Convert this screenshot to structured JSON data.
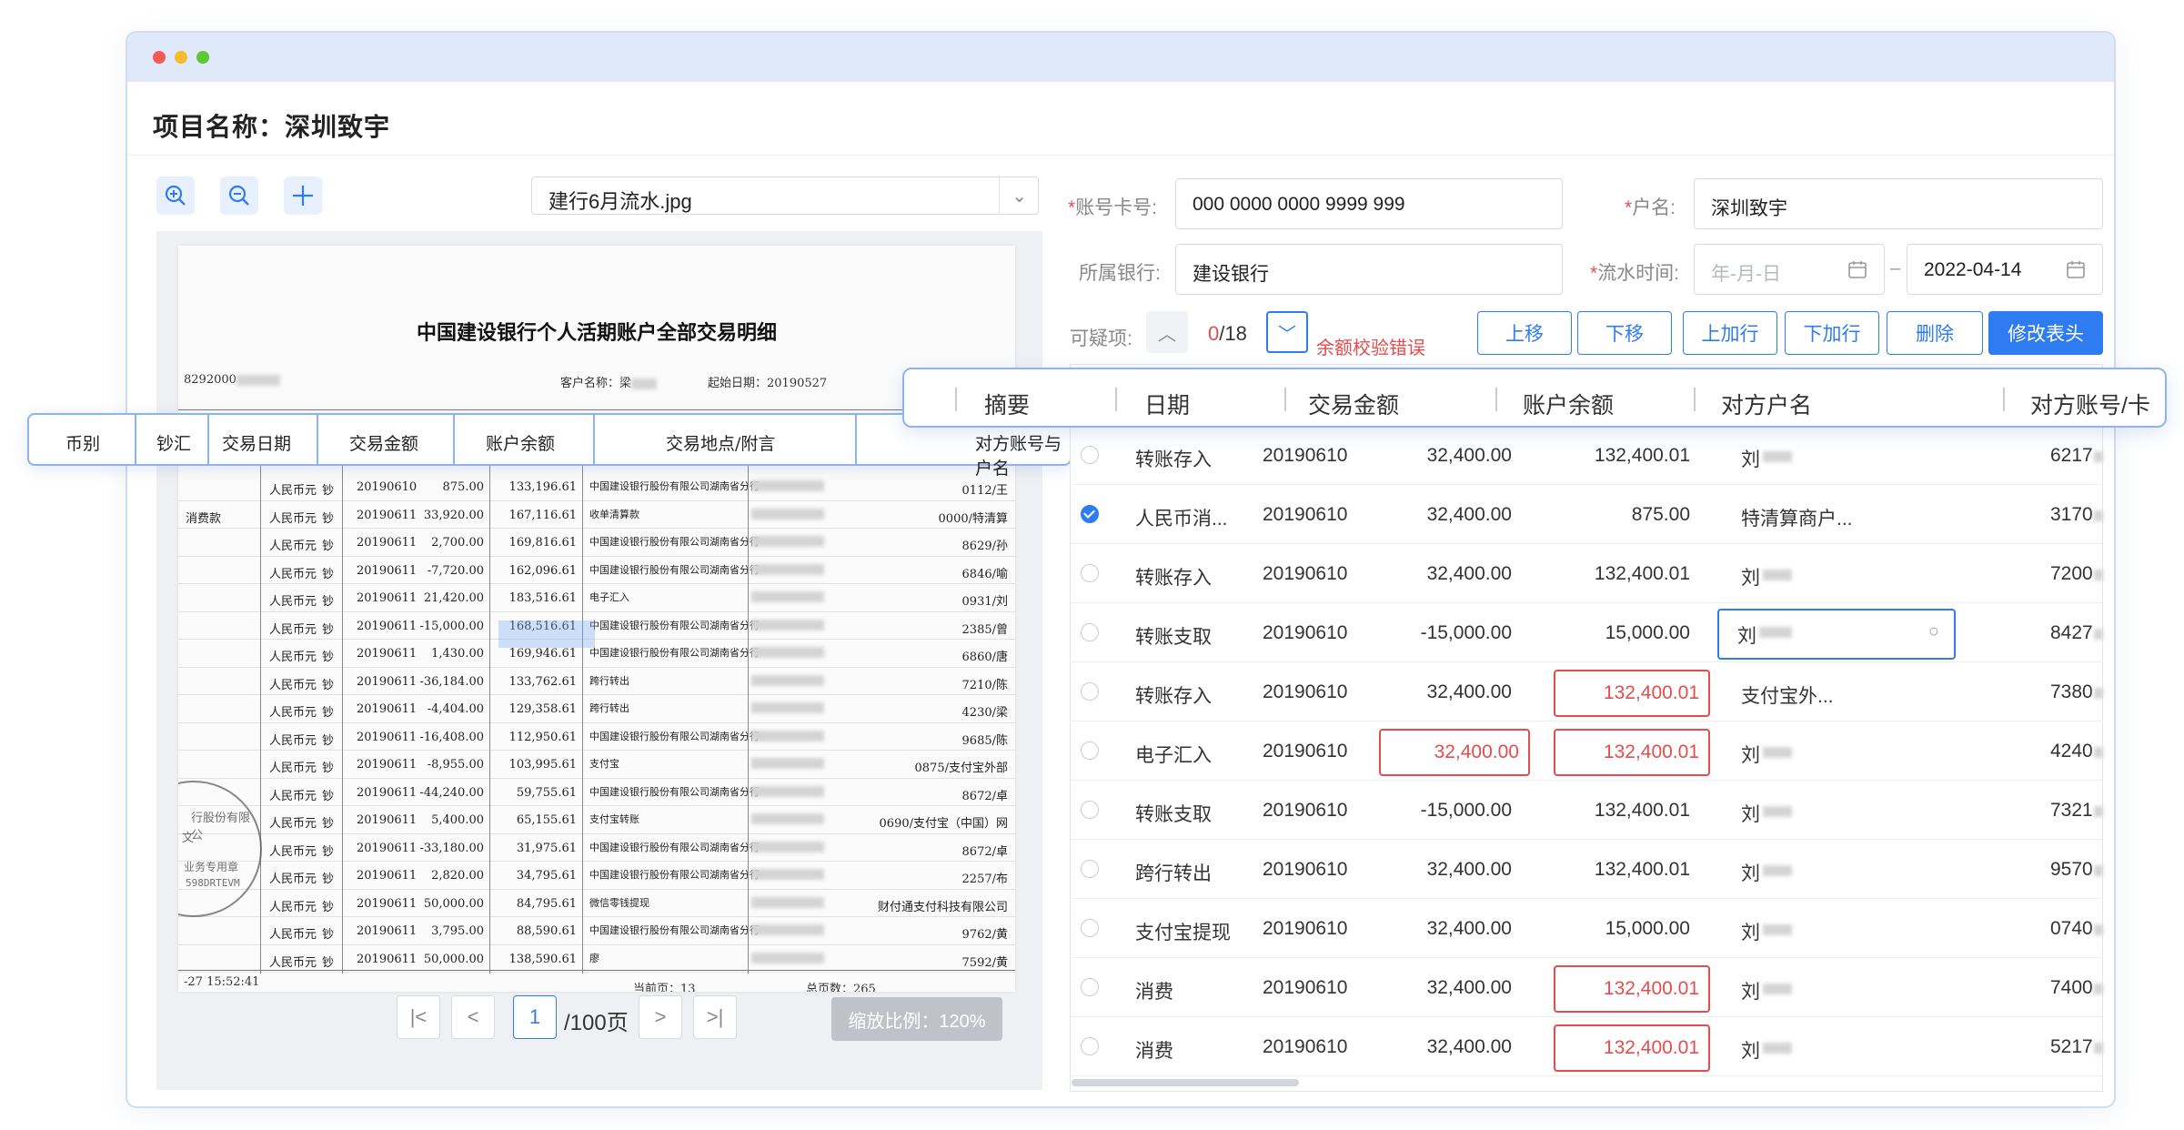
{
  "window": {
    "controls": [
      "close",
      "minimize",
      "maximize"
    ],
    "control_colors": {
      "close": "#f25a52",
      "minimize": "#f5bd2d",
      "maximize": "#5cc834"
    }
  },
  "project": {
    "title": "项目名称：深圳致宇"
  },
  "toolbar": {
    "icons": [
      "zoom-in-icon",
      "zoom-out-icon",
      "move-icon"
    ],
    "file_select": {
      "value": "建行6月流水.jpg"
    }
  },
  "document": {
    "title": "中国建设银行个人活期账户全部交易明细",
    "meta": {
      "acct_prefix": "8292000",
      "customer_label": "客户名称：梁",
      "start_date": "起始日期：20190527"
    },
    "headers": [
      "币别",
      "钞汇",
      "交易日期",
      "交易金额",
      "账户余额",
      "交易地点/附言",
      "对方账号与户名"
    ],
    "rows": [
      {
        "left": "",
        "cur": "人民币元",
        "ch": "钞",
        "date": "20190610",
        "amt": "875.00",
        "bal": "133,196.61",
        "place": "中国建设银行股份有限公司湖南省分行",
        "other": "0112/王"
      },
      {
        "left": "消费款",
        "cur": "人民币元",
        "ch": "钞",
        "date": "20190611",
        "amt": "33,920.00",
        "bal": "167,116.61",
        "place": "收单清算款",
        "other": "0000/特清算"
      },
      {
        "left": "",
        "cur": "人民币元",
        "ch": "钞",
        "date": "20190611",
        "amt": "2,700.00",
        "bal": "169,816.61",
        "place": "中国建设银行股份有限公司湖南省分行",
        "other": "8629/孙"
      },
      {
        "left": "",
        "cur": "人民币元",
        "ch": "钞",
        "date": "20190611",
        "amt": "-7,720.00",
        "bal": "162,096.61",
        "place": "中国建设银行股份有限公司湖南省分行",
        "other": "6846/喻"
      },
      {
        "left": "",
        "cur": "人民币元",
        "ch": "钞",
        "date": "20190611",
        "amt": "21,420.00",
        "bal": "183,516.61",
        "place": "电子汇入",
        "other": "0931/刘"
      },
      {
        "left": "",
        "cur": "人民币元",
        "ch": "钞",
        "date": "20190611",
        "amt": "-15,000.00",
        "bal": "168,516.61",
        "place": "中国建设银行股份有限公司湖南省分行",
        "other": "2385/曾"
      },
      {
        "left": "",
        "cur": "人民币元",
        "ch": "钞",
        "date": "20190611",
        "amt": "1,430.00",
        "bal": "169,946.61",
        "place": "中国建设银行股份有限公司湖南省分行",
        "other": "6860/唐"
      },
      {
        "left": "",
        "cur": "人民币元",
        "ch": "钞",
        "date": "20190611",
        "amt": "-36,184.00",
        "bal": "133,762.61",
        "place": "跨行转出",
        "other": "7210/陈"
      },
      {
        "left": "",
        "cur": "人民币元",
        "ch": "钞",
        "date": "20190611",
        "amt": "-4,404.00",
        "bal": "129,358.61",
        "place": "跨行转出",
        "other": "4230/梁"
      },
      {
        "left": "",
        "cur": "人民币元",
        "ch": "钞",
        "date": "20190611",
        "amt": "-16,408.00",
        "bal": "112,950.61",
        "place": "中国建设银行股份有限公司湖南省分行",
        "other": "9685/陈"
      },
      {
        "left": "",
        "cur": "人民币元",
        "ch": "钞",
        "date": "20190611",
        "amt": "-8,955.00",
        "bal": "103,995.61",
        "place": "支付宝",
        "other": "0875/支付宝外部"
      },
      {
        "left": "",
        "cur": "人民币元",
        "ch": "钞",
        "date": "20190611",
        "amt": "-44,240.00",
        "bal": "59,755.61",
        "place": "中国建设银行股份有限公司湖南省分行",
        "other": "8672/卓"
      },
      {
        "left": "",
        "cur": "人民币元",
        "ch": "钞",
        "date": "20190611",
        "amt": "5,400.00",
        "bal": "65,155.61",
        "place": "支付宝转账",
        "other": "0690/支付宝（中国）网"
      },
      {
        "left": "",
        "cur": "人民币元",
        "ch": "钞",
        "date": "20190611",
        "amt": "-33,180.00",
        "bal": "31,975.61",
        "place": "中国建设银行股份有限公司湖南省分行",
        "other": "8672/卓"
      },
      {
        "left": "",
        "cur": "人民币元",
        "ch": "钞",
        "date": "20190611",
        "amt": "2,820.00",
        "bal": "34,795.61",
        "place": "中国建设银行股份有限公司湖南省分行",
        "other": "2257/布"
      },
      {
        "left": "",
        "cur": "人民币元",
        "ch": "钞",
        "date": "20190611",
        "amt": "50,000.00",
        "bal": "84,795.61",
        "place": "微信零钱提现",
        "other": "财付通支付科技有限公司"
      },
      {
        "left": "",
        "cur": "人民币元",
        "ch": "钞",
        "date": "20190611",
        "amt": "3,795.00",
        "bal": "88,590.61",
        "place": "中国建设银行股份有限公司湖南省分行",
        "other": "9762/黄"
      },
      {
        "left": "",
        "cur": "人民币元",
        "ch": "钞",
        "date": "20190611",
        "amt": "50,000.00",
        "bal": "138,590.61",
        "place": "廖",
        "other": "7592/黄"
      }
    ],
    "footer": {
      "time": "-27 15:52:41",
      "current_page": "当前页：13",
      "total_pages": "总页数：265"
    },
    "stamp": {
      "lines": [
        "行股份有限公",
        "业务专用章",
        "598DRTEVM",
        "文"
      ]
    }
  },
  "pager": {
    "current": "1",
    "total": "/100页",
    "zoom": "缩放比例：120%"
  },
  "form": {
    "account_label": "账号卡号:",
    "account_value": "000 0000 0000 9999 999",
    "name_label": "户名:",
    "name_value": "深圳致宇",
    "bank_label": "所属银行:",
    "bank_value": "建设银行",
    "time_label": "流水时间:",
    "date_from_placeholder": "年-月-日",
    "date_sep": "–",
    "date_to": "2022-04-14"
  },
  "suspicious": {
    "label": "可疑项:",
    "current": "0",
    "total": "/18",
    "error": "余额校验错误"
  },
  "actions": [
    "上移",
    "下移",
    "上加行",
    "下加行",
    "删除",
    "修改表头"
  ],
  "table": {
    "headers": [
      "摘要",
      "日期",
      "交易金额",
      "账户余额",
      "对方户名",
      "对方账号/卡"
    ],
    "rows": [
      {
        "summary": "转账存入",
        "date": "20190610",
        "amount": "32,400.00",
        "balance": "132,400.01",
        "payee": "刘",
        "acct": "6217",
        "checked": false,
        "amt_err": false,
        "bal_err": false
      },
      {
        "summary": "人民币消...",
        "date": "20190610",
        "amount": "32,400.00",
        "balance": "875.00",
        "payee": "特清算商户...",
        "acct": "3170",
        "checked": true,
        "amt_err": false,
        "bal_err": false
      },
      {
        "summary": "转账存入",
        "date": "20190610",
        "amount": "32,400.00",
        "balance": "132,400.01",
        "payee": "刘",
        "acct": "7200",
        "checked": false,
        "amt_err": false,
        "bal_err": false
      },
      {
        "summary": "转账支取",
        "date": "20190610",
        "amount": "-15,000.00",
        "balance": "15,000.00",
        "payee": "刘",
        "acct": "8427",
        "checked": false,
        "amt_err": false,
        "bal_err": false,
        "editing": true
      },
      {
        "summary": "转账存入",
        "date": "20190610",
        "amount": "32,400.00",
        "balance": "132,400.01",
        "payee": "支付宝外...",
        "acct": "7380",
        "checked": false,
        "amt_err": false,
        "bal_err": true
      },
      {
        "summary": "电子汇入",
        "date": "20190610",
        "amount": "32,400.00",
        "balance": "132,400.01",
        "payee": "刘",
        "acct": "4240",
        "checked": false,
        "amt_err": true,
        "bal_err": true
      },
      {
        "summary": "转账支取",
        "date": "20190610",
        "amount": "-15,000.00",
        "balance": "132,400.01",
        "payee": "刘",
        "acct": "7321",
        "checked": false,
        "amt_err": false,
        "bal_err": false
      },
      {
        "summary": "跨行转出",
        "date": "20190610",
        "amount": "32,400.00",
        "balance": "132,400.01",
        "payee": "刘",
        "acct": "9570",
        "checked": false,
        "amt_err": false,
        "bal_err": false
      },
      {
        "summary": "支付宝提现",
        "date": "20190610",
        "amount": "32,400.00",
        "balance": "15,000.00",
        "payee": "刘",
        "acct": "0740",
        "checked": false,
        "amt_err": false,
        "bal_err": false
      },
      {
        "summary": "消费",
        "date": "20190610",
        "amount": "32,400.00",
        "balance": "132,400.01",
        "payee": "刘",
        "acct": "7400",
        "checked": false,
        "amt_err": false,
        "bal_err": true
      },
      {
        "summary": "消费",
        "date": "20190610",
        "amount": "32,400.00",
        "balance": "132,400.01",
        "payee": "刘",
        "acct": "5217",
        "checked": false,
        "amt_err": false,
        "bal_err": true
      }
    ]
  },
  "colors": {
    "accent": "#2f7bf0",
    "error": "#e34d4d",
    "highlight": "#8fb3ef"
  }
}
